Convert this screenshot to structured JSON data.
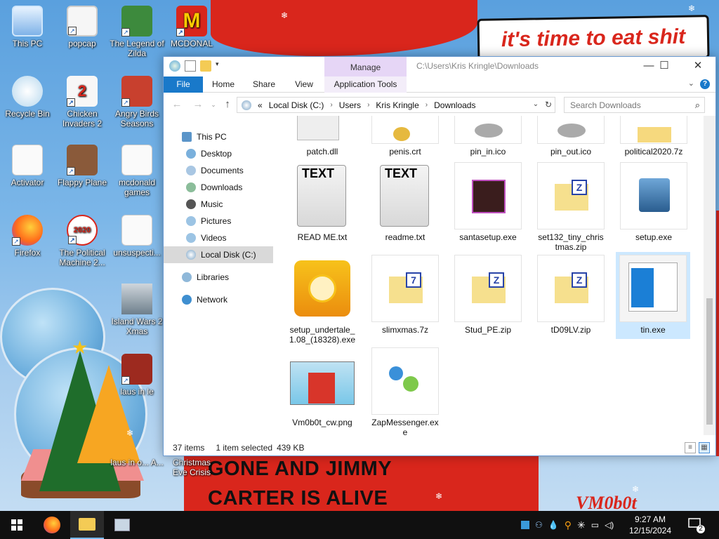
{
  "wallpaper": {
    "banner_text": "it's time to eat shit",
    "bottom_line1": "GONE AND JIMMY",
    "bottom_line2": "CARTER IS ALIVE",
    "signature": "VM0b0t"
  },
  "desktop_icons": [
    {
      "label": "This PC"
    },
    {
      "label": "popcap"
    },
    {
      "label": "The Legend of Zilda"
    },
    {
      "label": "MCDONAL"
    },
    {
      "label": "Recycle Bin"
    },
    {
      "label": "Chicken Invaders 2"
    },
    {
      "label": "Angry Birds Seasons"
    },
    {
      "label": "Activator"
    },
    {
      "label": "Flappy Plane"
    },
    {
      "label": "mcdonald games"
    },
    {
      "label": "Firefox"
    },
    {
      "label": "The Political Machine 2..."
    },
    {
      "label": "unsuspecti..."
    },
    {
      "label": "Island Wars 2 Xmas"
    },
    {
      "label": "laus in le"
    },
    {
      "label": "Christmas Eve Crisis"
    },
    {
      "label": "laus in o... A..."
    }
  ],
  "window": {
    "title_path": "C:\\Users\\Kris Kringle\\Downloads",
    "manage_tab": "Manage",
    "ribbon_tabs": [
      "File",
      "Home",
      "Share",
      "View",
      "Application Tools"
    ],
    "help_label": "?",
    "address": {
      "prefix": "«",
      "crumbs": [
        "Local Disk (C:)",
        "Users",
        "Kris Kringle",
        "Downloads"
      ]
    },
    "search_placeholder": "Search Downloads",
    "nav": [
      {
        "label": "This PC"
      },
      {
        "label": "Desktop"
      },
      {
        "label": "Documents"
      },
      {
        "label": "Downloads"
      },
      {
        "label": "Music"
      },
      {
        "label": "Pictures"
      },
      {
        "label": "Videos"
      },
      {
        "label": "Local Disk (C:)"
      },
      {
        "label": "Libraries"
      },
      {
        "label": "Network"
      }
    ],
    "files": [
      {
        "name": "patch.dll"
      },
      {
        "name": "penis.crt"
      },
      {
        "name": "pin_in.ico"
      },
      {
        "name": "pin_out.ico"
      },
      {
        "name": "political2020.7z"
      },
      {
        "name": "READ ME.txt",
        "badge": "TEXT"
      },
      {
        "name": "readme.txt",
        "badge": "TEXT"
      },
      {
        "name": "santasetup.exe"
      },
      {
        "name": "set132_tiny_christmas.zip",
        "badge": "Z"
      },
      {
        "name": "setup.exe"
      },
      {
        "name": "setup_undertale_1.08_(18328).exe"
      },
      {
        "name": "slimxmas.7z",
        "badge": "7"
      },
      {
        "name": "Stud_PE.zip",
        "badge": "Z"
      },
      {
        "name": "tD09LV.zip",
        "badge": "Z"
      },
      {
        "name": "tin.exe"
      },
      {
        "name": "Vm0b0t_cw.png"
      },
      {
        "name": "ZapMessenger.exe"
      }
    ],
    "status": {
      "items_count": "37 items",
      "selection": "1 item selected",
      "size": "439 KB"
    }
  },
  "taskbar": {
    "time": "9:27 AM",
    "date": "12/15/2024",
    "notification_count": "2"
  }
}
